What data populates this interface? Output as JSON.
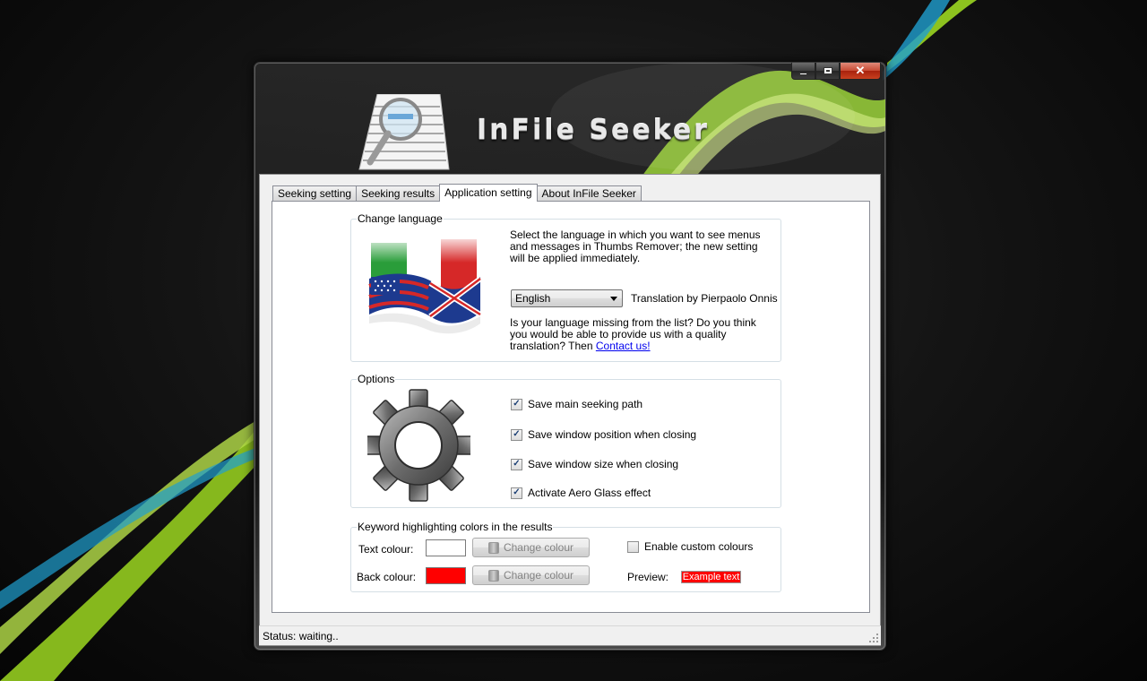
{
  "window": {
    "title": "InFile Seeker",
    "caption_buttons": {
      "minimize": "minimize",
      "maximize": "maximize",
      "close": "close"
    }
  },
  "tabs": [
    {
      "label": "Seeking setting",
      "active": false
    },
    {
      "label": "Seeking results",
      "active": false
    },
    {
      "label": "Application setting",
      "active": true
    },
    {
      "label": "About InFile Seeker",
      "active": false
    }
  ],
  "language": {
    "legend": "Change language",
    "description": "Select the language in which you want to see menus and messages in Thumbs Remover; the new setting will be applied immediately.",
    "selected": "English",
    "translation_credit": "Translation by Pierpaolo Onnis",
    "missing_text": "Is your language missing from the list? Do you think you would be able to provide us with a quality translation? Then",
    "contact_link": "Contact us!"
  },
  "options": {
    "legend": "Options",
    "items": [
      {
        "label": "Save main seeking path",
        "checked": true
      },
      {
        "label": "Save window position when closing",
        "checked": true
      },
      {
        "label": "Save window size when closing",
        "checked": true
      },
      {
        "label": "Activate Aero Glass effect",
        "checked": true
      }
    ]
  },
  "keyword": {
    "legend": "Keyword highlighting colors in the results",
    "text_colour_label": "Text colour:",
    "back_colour_label": "Back colour:",
    "change_colour_label": "Change colour",
    "enable_custom_label": "Enable custom colours",
    "enable_custom_checked": false,
    "preview_label": "Preview:",
    "example_text": "Example text",
    "text_colour": "#ffffff",
    "back_colour": "#ff0000"
  },
  "status": {
    "text": "Status: waiting.."
  },
  "colors": {
    "accent_green": "#8dc21f",
    "accent_blue": "#1f9fd0"
  },
  "icons": {
    "app_logo": "magnifier-document-icon",
    "language": "flags-icon",
    "options": "gear-icon",
    "button": "palette-icon"
  }
}
